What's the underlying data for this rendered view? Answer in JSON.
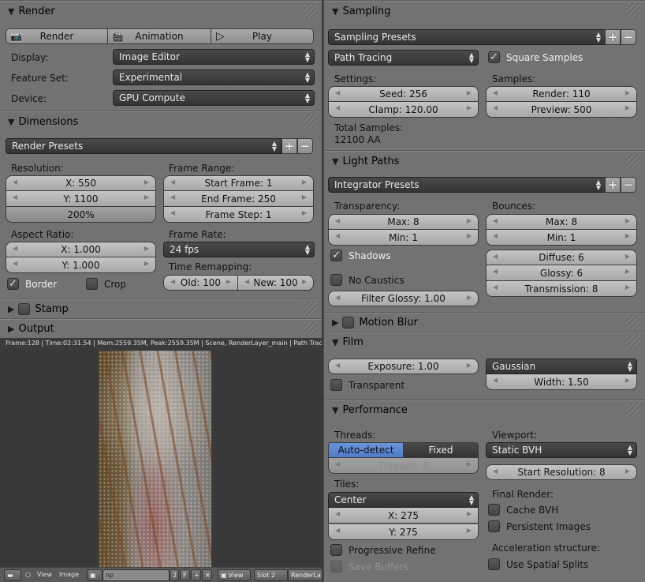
{
  "render": {
    "title": "Render",
    "buttons": {
      "render": "Render",
      "animation": "Animation",
      "play": "Play"
    },
    "display_label": "Display:",
    "display_value": "Image Editor",
    "feature_set_label": "Feature Set:",
    "feature_set_value": "Experimental",
    "device_label": "Device:",
    "device_value": "GPU Compute"
  },
  "dimensions": {
    "title": "Dimensions",
    "presets": "Render Presets",
    "resolution_label": "Resolution:",
    "res_x": "X: 550",
    "res_y": "Y: 1100",
    "res_pct": "200%",
    "frame_range_label": "Frame Range:",
    "start_frame": "Start Frame: 1",
    "end_frame": "End Frame: 250",
    "frame_step": "Frame Step: 1",
    "aspect_label": "Aspect Ratio:",
    "aspect_x": "X: 1.000",
    "aspect_y": "Y: 1.000",
    "frame_rate_label": "Frame Rate:",
    "frame_rate_value": "24 fps",
    "time_remap_label": "Time Remapping:",
    "old": "Old: 100",
    "new": "New: 100",
    "border_label": "Border",
    "border_checked": true,
    "crop_label": "Crop",
    "crop_checked": false
  },
  "stamp": {
    "title": "Stamp",
    "checked": false
  },
  "output": {
    "title": "Output"
  },
  "image_editor": {
    "info": "Frame:128 | Time:02:31.54 | Mem:2559.35M, Peak:2559.35M | Scene, RenderLayer_main | Path Tracing Sam",
    "menu_view": "View",
    "menu_image": "Image",
    "image_name": "np",
    "users": "2",
    "fake": "F",
    "view_label": "View",
    "slot": "Slot 2",
    "layer": "RenderLa"
  },
  "sampling": {
    "title": "Sampling",
    "presets": "Sampling Presets",
    "integrator": "Path Tracing",
    "square_samples_label": "Square Samples",
    "square_samples_checked": true,
    "settings_label": "Settings:",
    "seed": "Seed: 256",
    "clamp": "Clamp: 120.00",
    "samples_label": "Samples:",
    "render": "Render: 110",
    "preview": "Preview: 500",
    "total_label": "Total Samples:",
    "total_value": "12100 AA"
  },
  "light_paths": {
    "title": "Light Paths",
    "presets": "Integrator Presets",
    "transparency_label": "Transparency:",
    "t_max": "Max: 8",
    "t_min": "Min: 1",
    "shadows_label": "Shadows",
    "shadows_checked": true,
    "no_caustics_label": "No Caustics",
    "no_caustics_checked": false,
    "filter_glossy": "Filter Glossy: 1.00",
    "bounces_label": "Bounces:",
    "b_max": "Max: 8",
    "b_min": "Min: 1",
    "diffuse": "Diffuse: 6",
    "glossy": "Glossy: 6",
    "transmission": "Transmission: 8"
  },
  "motion_blur": {
    "title": "Motion Blur",
    "checked": false
  },
  "film": {
    "title": "Film",
    "exposure": "Exposure: 1.00",
    "transparent_label": "Transparent",
    "transparent_checked": false,
    "filter": "Gaussian",
    "width": "Width: 1.50"
  },
  "performance": {
    "title": "Performance",
    "threads_label": "Threads:",
    "auto_detect": "Auto-detect",
    "fixed": "Fixed",
    "threads_value": "Threads: 8",
    "tiles_label": "Tiles:",
    "tiles_order": "Center",
    "tile_x": "X: 275",
    "tile_y": "Y: 275",
    "progressive_label": "Progressive Refine",
    "save_buffers_label": "Save Buffers",
    "viewport_label": "Viewport:",
    "viewport_value": "Static BVH",
    "start_resolution": "Start Resolution: 8",
    "final_render_label": "Final Render:",
    "cache_bvh_label": "Cache BVH",
    "persistent_images_label": "Persistent Images",
    "accel_label": "Acceleration structure:",
    "spatial_splits_label": "Use Spatial Splits"
  }
}
